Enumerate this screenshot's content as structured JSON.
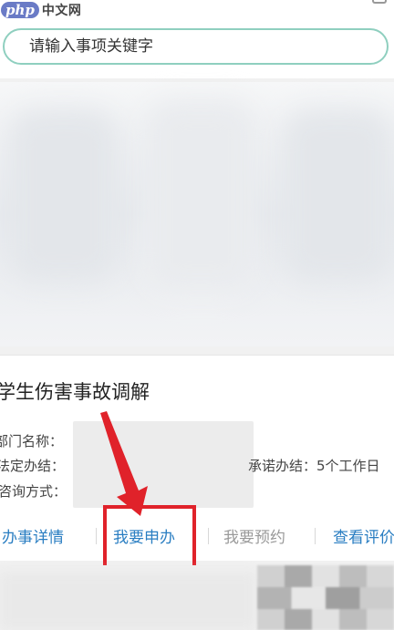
{
  "logo": {
    "php": "php",
    "site": "中文网"
  },
  "search": {
    "placeholder": "请输入事项关键字"
  },
  "item": {
    "title": "学生伤害事故调解",
    "department_label": "部门名称：",
    "legal_label": "法定办结：",
    "contact_label": "咨询方式：",
    "promise_text": "承诺办结：5个工作日"
  },
  "actions": {
    "details": "办事详情",
    "apply": "我要申办",
    "reserve": "我要预约",
    "review": "查看评价"
  },
  "colors": {
    "accent": "#2a7ec2",
    "highlight": "#e0222a",
    "search_border": "#8fcfbf"
  }
}
